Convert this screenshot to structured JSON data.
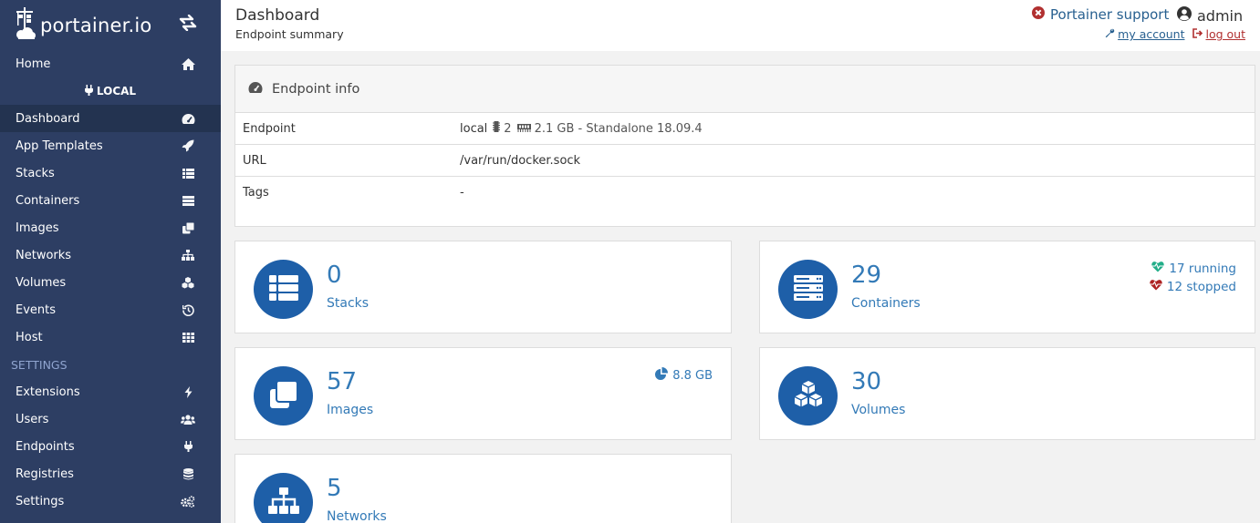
{
  "brand": {
    "logo_text": "portainer.io"
  },
  "sidebar": {
    "items": [
      {
        "label": "Home",
        "icon": "home-icon"
      },
      {
        "label": "Dashboard",
        "icon": "tachometer-icon"
      },
      {
        "label": "App Templates",
        "icon": "rocket-icon"
      },
      {
        "label": "Stacks",
        "icon": "th-list-icon"
      },
      {
        "label": "Containers",
        "icon": "server-icon"
      },
      {
        "label": "Images",
        "icon": "clone-icon"
      },
      {
        "label": "Networks",
        "icon": "sitemap-icon"
      },
      {
        "label": "Volumes",
        "icon": "cubes-icon"
      },
      {
        "label": "Events",
        "icon": "history-icon"
      },
      {
        "label": "Host",
        "icon": "th-icon"
      }
    ],
    "endpoint_label": "LOCAL",
    "settings_heading": "SETTINGS",
    "settings_items": [
      {
        "label": "Extensions",
        "icon": "bolt-icon"
      },
      {
        "label": "Users",
        "icon": "users-icon"
      },
      {
        "label": "Endpoints",
        "icon": "plug-icon"
      },
      {
        "label": "Registries",
        "icon": "database-icon"
      },
      {
        "label": "Settings",
        "icon": "cogs-icon"
      }
    ]
  },
  "header": {
    "title": "Dashboard",
    "subtitle": "Endpoint summary",
    "support_label": "Portainer support",
    "username": "admin",
    "my_account_label": "my account",
    "logout_label": "log out"
  },
  "endpoint_info": {
    "heading": "Endpoint info",
    "rows": {
      "endpoint": {
        "key": "Endpoint",
        "name": "local",
        "cpus": "2",
        "memory": "2.1 GB - Standalone 18.09.4"
      },
      "url": {
        "key": "URL",
        "value": "/var/run/docker.sock"
      },
      "tags": {
        "key": "Tags",
        "value": "-"
      }
    }
  },
  "widgets": {
    "stacks": {
      "count": "0",
      "label": "Stacks"
    },
    "containers": {
      "count": "29",
      "label": "Containers",
      "running": "17 running",
      "stopped": "12 stopped"
    },
    "images": {
      "count": "57",
      "label": "Images",
      "size": "8.8 GB"
    },
    "volumes": {
      "count": "30",
      "label": "Volumes"
    },
    "networks": {
      "count": "5",
      "label": "Networks"
    }
  },
  "colors": {
    "sidebar_bg": "#2d3e63",
    "sidebar_active": "#233350",
    "accent": "#1e5fa8",
    "link": "#337ab7",
    "running": "#23ae89",
    "stopped": "#ae2323",
    "danger": "#b13030"
  }
}
